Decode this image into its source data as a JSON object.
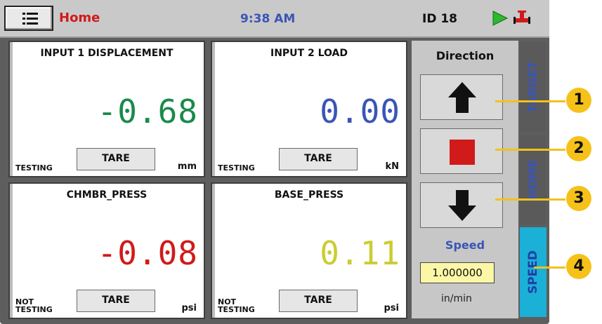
{
  "topbar": {
    "title": "Home",
    "time": "9:38 AM",
    "device_id": "ID 18",
    "menu_icon": "list-icon",
    "status_icons": [
      "play-icon",
      "valve-icon"
    ]
  },
  "panels": [
    {
      "title": "INPUT 1 DISPLACEMENT",
      "value": "-0.68",
      "status": "TESTING",
      "tare": "TARE",
      "unit": "mm",
      "color": "#1a8a4a"
    },
    {
      "title": "INPUT 2 LOAD",
      "value": "0.00",
      "status": "TESTING",
      "tare": "TARE",
      "unit": "kN",
      "color": "#3a55b6"
    },
    {
      "title": "CHMBR_PRESS",
      "value": "-0.08",
      "status_line1": "NOT",
      "status_line2": "TESTING",
      "tare": "TARE",
      "unit": "psi",
      "color": "#d11a1a"
    },
    {
      "title": "BASE_PRESS",
      "value": "0.11",
      "status_line1": "NOT",
      "status_line2": "TESTING",
      "tare": "TARE",
      "unit": "psi",
      "color": "#cccc33"
    }
  ],
  "direction": {
    "title": "Direction",
    "buttons": [
      "arrow-up-icon",
      "stop-icon",
      "arrow-down-icon"
    ],
    "speed_label": "Speed",
    "speed_value": "1.000000",
    "speed_unit": "in/min"
  },
  "side_tabs": [
    {
      "label": "TARGET",
      "active": false
    },
    {
      "label": "HOME",
      "active": false
    },
    {
      "label": "SPEED",
      "active": true
    }
  ],
  "callouts": [
    "1",
    "2",
    "3",
    "4"
  ],
  "colors": {
    "accent_red": "#d11a1a",
    "accent_blue": "#3a55b6",
    "callout": "#f6c21a",
    "active_tab": "#1bb0d6"
  }
}
